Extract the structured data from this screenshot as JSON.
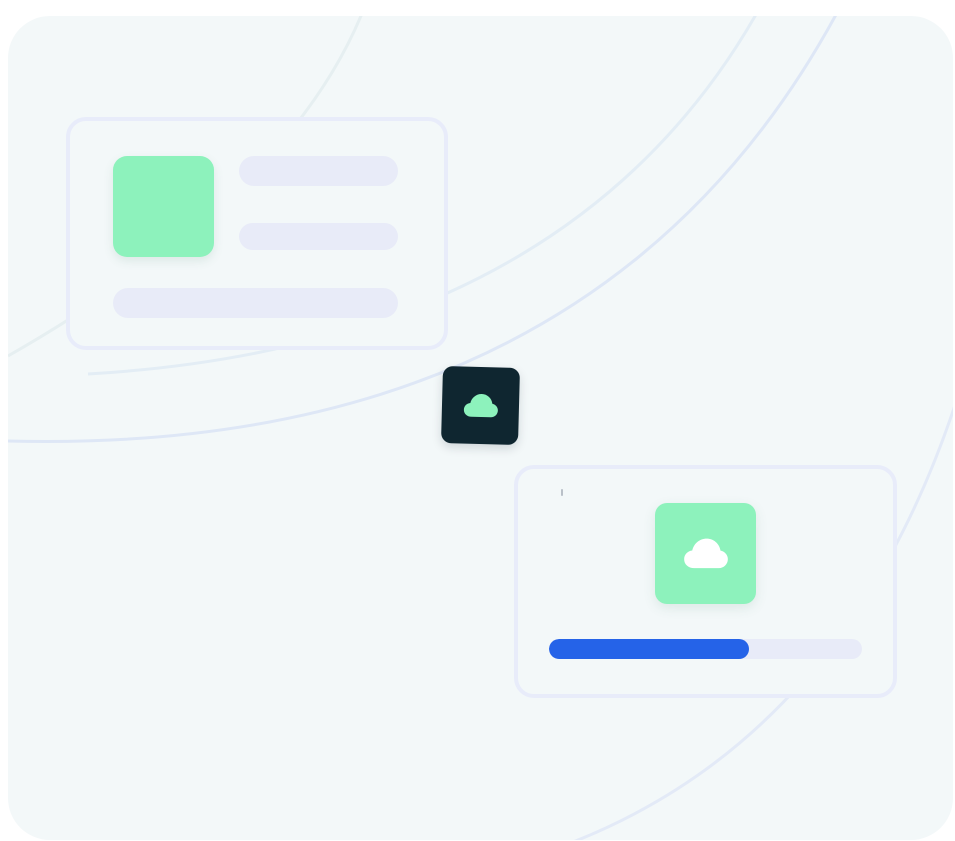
{
  "colors": {
    "background": "#f3f8f9",
    "card_border": "#e8ecfa",
    "skeleton": "#e8ebf8",
    "accent_green": "#8df2bc",
    "dark_badge": "#0f2630",
    "progress_blue": "#2563e8"
  },
  "profile_card": {
    "thumbnail": "green-square",
    "placeholder_lines": 3
  },
  "center_badge": {
    "icon": "cloud-icon"
  },
  "upload_card": {
    "icon": "cloud-icon",
    "progress": 0.64
  }
}
